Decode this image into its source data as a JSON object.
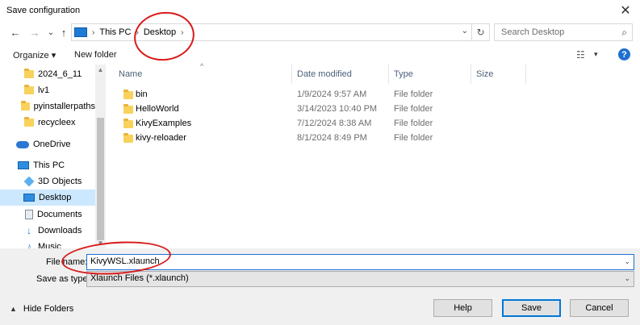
{
  "window": {
    "title": "Save configuration",
    "close_glyph": "✕"
  },
  "navbar": {
    "back_glyph": "←",
    "forward_glyph": "→",
    "history_glyph": "⌄",
    "up_glyph": "↑",
    "breadcrumb": [
      "This PC",
      "Desktop"
    ],
    "separator": "›",
    "dropdown_glyph": "⌄",
    "refresh_glyph": "↻",
    "search_placeholder": "Search Desktop",
    "search_glyph": "⌕"
  },
  "toolbar": {
    "organize_label": "Organize ▾",
    "new_folder_label": "New folder",
    "view_glyph": "☷",
    "view_dd_glyph": "▾",
    "help_glyph": "?"
  },
  "nav_pane": {
    "items": [
      {
        "label": "2024_6_11",
        "icon": "folder-icon"
      },
      {
        "label": "lv1",
        "icon": "folder-icon"
      },
      {
        "label": "pyinstallerpaths",
        "icon": "folder-icon"
      },
      {
        "label": "recycleex",
        "icon": "folder-icon"
      },
      {
        "label": "OneDrive",
        "icon": "cloud-icon"
      },
      {
        "label": "This PC",
        "icon": "computer-icon"
      },
      {
        "label": "3D Objects",
        "icon": "cube-icon"
      },
      {
        "label": "Desktop",
        "icon": "desktop-icon",
        "selected": true
      },
      {
        "label": "Documents",
        "icon": "document-icon"
      },
      {
        "label": "Downloads",
        "icon": "download-icon"
      },
      {
        "label": "Music",
        "icon": "music-icon"
      }
    ],
    "scroll_up_glyph": "▲",
    "scroll_down_glyph": "▼"
  },
  "columns": {
    "name": "Name",
    "date": "Date modified",
    "type": "Type",
    "size": "Size",
    "sort_glyph": "^"
  },
  "files": [
    {
      "name": "bin",
      "date": "1/9/2024 9:57 AM",
      "type": "File folder"
    },
    {
      "name": "HelloWorld",
      "date": "3/14/2023 10:40 PM",
      "type": "File folder"
    },
    {
      "name": "KivyExamples",
      "date": "7/12/2024 8:38 AM",
      "type": "File folder"
    },
    {
      "name": "kivy-reloader",
      "date": "8/1/2024 8:49 PM",
      "type": "File folder"
    }
  ],
  "footer": {
    "filename_label": "File name:",
    "filename_value": "KivyWSL.xlaunch",
    "savetype_label": "Save as type:",
    "savetype_value": "Xlaunch Files (*.xlaunch)",
    "dd_glyph": "⌄",
    "hide_folders_label": "Hide Folders",
    "hide_glyph": "▲",
    "help_button": "Help",
    "save_button": "Save",
    "cancel_button": "Cancel"
  },
  "colors": {
    "accent": "#0078d7",
    "selection": "#cce8ff",
    "annotation": "#d91a1a"
  }
}
